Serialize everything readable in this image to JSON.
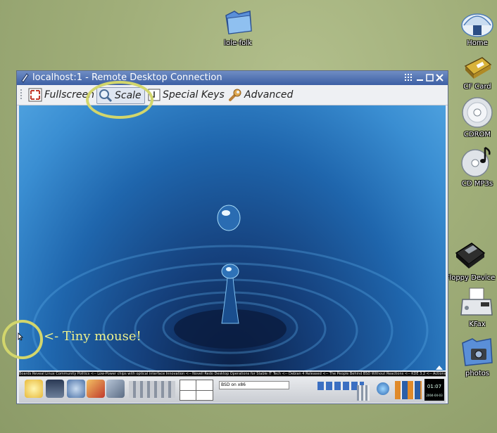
{
  "desktop": {
    "icons": [
      {
        "name": "folder-icon",
        "label": "lole-folk"
      },
      {
        "name": "home-icon",
        "label": "Home"
      },
      {
        "name": "cf-card-icon",
        "label": "CF Card"
      },
      {
        "name": "cdrom-icon",
        "label": "CDROM"
      },
      {
        "name": "cd-mp3-icon",
        "label": "CD MP3s"
      },
      {
        "name": "floppy-icon",
        "label": "Floppy Device"
      },
      {
        "name": "fax-icon",
        "label": "KFax"
      },
      {
        "name": "photos-icon",
        "label": "photos"
      }
    ]
  },
  "window": {
    "title": "localhost:1 - Remote Desktop Connection",
    "toolbar": {
      "fullscreen": "Fullscreen",
      "scale": "Scale",
      "special_keys": "Special Keys",
      "advanced": "Advanced"
    }
  },
  "remote_panel": {
    "clock": "01:07",
    "date": "2004-04-03",
    "task_input": "BSD on x86",
    "ticker": "Boards Reveal Linux Community Politics <-- Low-Power chips with optical interface Innovation <-- Novell Redo Desktop Operations for Stable IT Tech <-- Debian 4 Released <-- The People Behind BSD Without Reactions <-- KDE 3.2 <-- Actions"
  },
  "annotation": {
    "label": "<- Tiny mouse!"
  },
  "colors": {
    "annotation": "#d2d66c",
    "titlebar": "#3c5fa4",
    "desktop": "#9dab77"
  }
}
